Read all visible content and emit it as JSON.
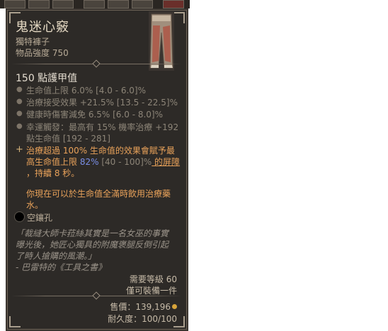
{
  "item": {
    "name": "鬼迷心竅",
    "type": "獨特褲子",
    "power": "物品強度 750",
    "armor": "150 點護甲值",
    "stats": [
      "生命值上限 6.0% [4.0 - 6.0]%",
      "治療接受效果 +21.5% [13.5 - 22.5]%",
      "健康時傷害減免 6.5% [6.0 - 8.0]%",
      "幸運觸發：最高有 15% 機率治療 +192",
      "點生命值 [192 - 281]"
    ],
    "aspect": {
      "line1": "治療超過 100% 生命值的效果會賦予最",
      "line2_pre": "高生命值上限 ",
      "line2_value": "82%",
      "line2_range": " [40 - 100]%",
      "line2_post": " 的屏障",
      "line3": "，持續 8 秒。",
      "line4": "你現在可以於生命值全滿時飲用治療藥",
      "line5": "水。"
    },
    "socket": "空鑲孔",
    "flavor": [
      "「裁縫大師卡菈絲其實是一名女巫的事實",
      "曝光後，她匠心獨具的附魔褒腿反倒引起",
      "了時人搶購的風潮。」",
      "- 巴雷特的《工具之書》"
    ],
    "requirement": "需要等級 60",
    "class_restriction": "僅可裝備一件",
    "sell_label": "售價：",
    "sell_value": "139,196",
    "durability": "耐久度：100/100",
    "gold_icon": "gold-coin-icon",
    "colors": {
      "aspect": "#e9a25a",
      "value_blue": "#7a8ee6",
      "stat": "#8d8578"
    }
  }
}
